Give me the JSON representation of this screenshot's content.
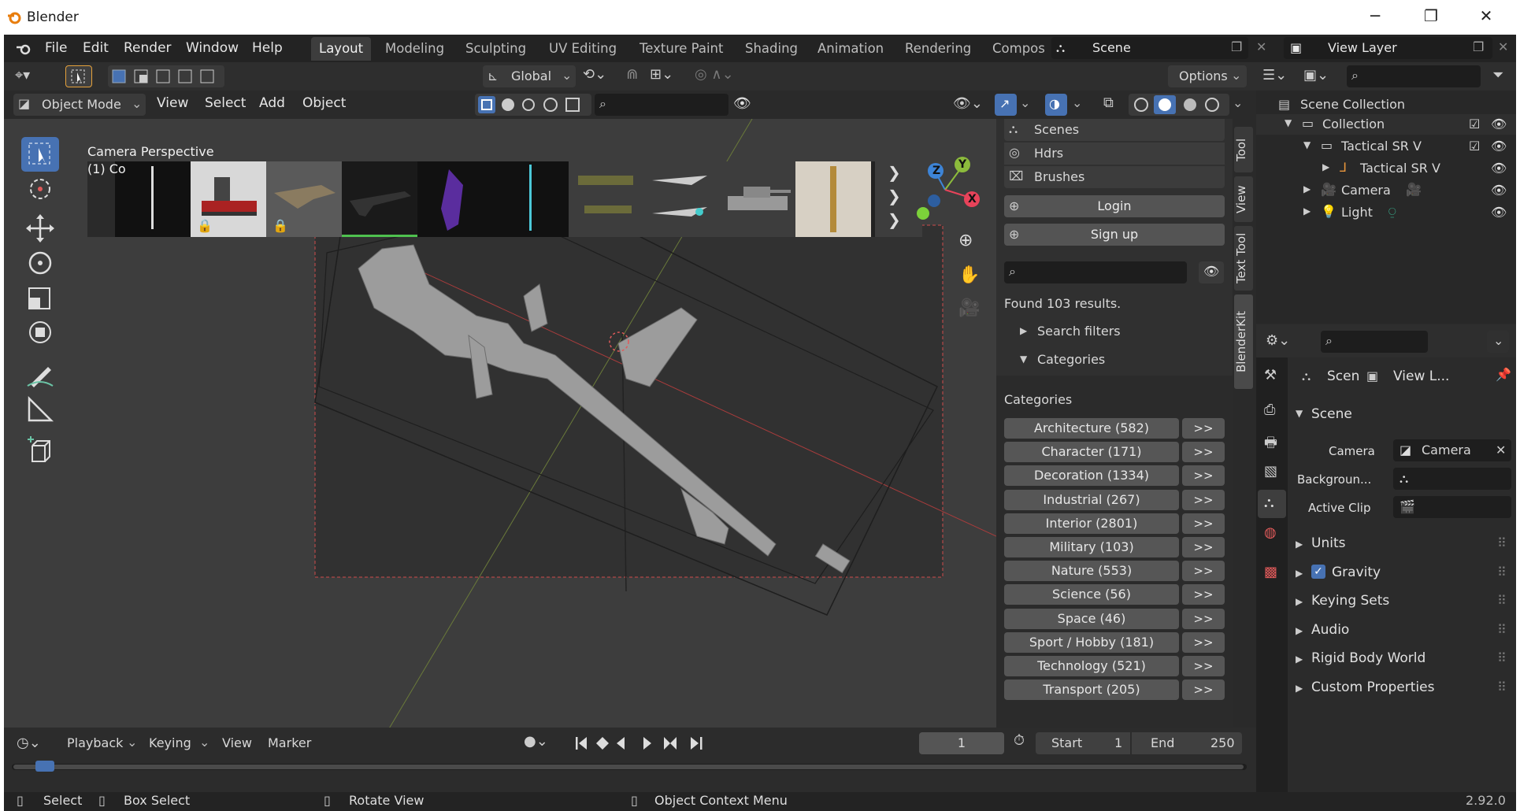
{
  "window": {
    "title": "Blender",
    "controls": [
      "─",
      "❐",
      "✕"
    ]
  },
  "menu": [
    "File",
    "Edit",
    "Render",
    "Window",
    "Help"
  ],
  "workspaces": [
    "Layout",
    "Modeling",
    "Sculpting",
    "UV Editing",
    "Texture Paint",
    "Shading",
    "Animation",
    "Rendering",
    "Compos"
  ],
  "scene_field": "Scene",
  "view_layer_field": "View Layer",
  "tool_header": {
    "transform_orientation": "Global",
    "options": "Options"
  },
  "viewport_header": {
    "mode": "Object Mode",
    "menus": [
      "View",
      "Select",
      "Add",
      "Object"
    ]
  },
  "viewport": {
    "camera_label": "Camera Perspective",
    "collection_label": "(1) Co"
  },
  "gizmo": {
    "z": "Z",
    "y": "Y",
    "x": "X"
  },
  "blenderkit": {
    "tabs": [
      "Scenes",
      "Hdrs",
      "Brushes"
    ],
    "login": "Login",
    "signup": "Sign up",
    "results": "Found 103 results.",
    "search_filters": "Search filters",
    "categories_toggle": "Categories",
    "categories_title": "Categories",
    "arrow_label": ">>",
    "categories": [
      "Architecture (582)",
      "Character (171)",
      "Decoration (1334)",
      "Industrial (267)",
      "Interior (2801)",
      "Military (103)",
      "Nature (553)",
      "Science (56)",
      "Space (46)",
      "Sport / Hobby (181)",
      "Technology (521)",
      "Transport (205)"
    ]
  },
  "side_tabs": [
    "Tool",
    "View",
    "Text Tool",
    "BlenderKit"
  ],
  "outliner": {
    "root": "Scene Collection",
    "items": [
      "Collection",
      "Tactical SR V",
      "Tactical SR V",
      "Camera",
      "Light"
    ]
  },
  "properties": {
    "breadcrumb_scene": "Scen",
    "breadcrumb_layer": "View L...",
    "panel_title": "Scene",
    "camera_label": "Camera",
    "camera_value": "Camera",
    "background_label": "Backgroun...",
    "active_clip_label": "Active Clip",
    "sections": [
      "Units",
      "Gravity",
      "Keying Sets",
      "Audio",
      "Rigid Body World",
      "Custom Properties"
    ]
  },
  "timeline": {
    "menus": [
      "Playback",
      "Keying",
      "View",
      "Marker"
    ],
    "current_frame": "1",
    "start_label": "Start",
    "start_value": "1",
    "end_label": "End",
    "end_value": "250"
  },
  "statusbar": {
    "select": "Select",
    "box_select": "Box Select",
    "rotate": "Rotate View",
    "context": "Object Context Menu",
    "version": "2.92.0"
  },
  "colors": {
    "accent": "#4772b3",
    "axis_x": "#e8435a",
    "axis_y": "#8cbb3c",
    "axis_z": "#3d84d7"
  }
}
